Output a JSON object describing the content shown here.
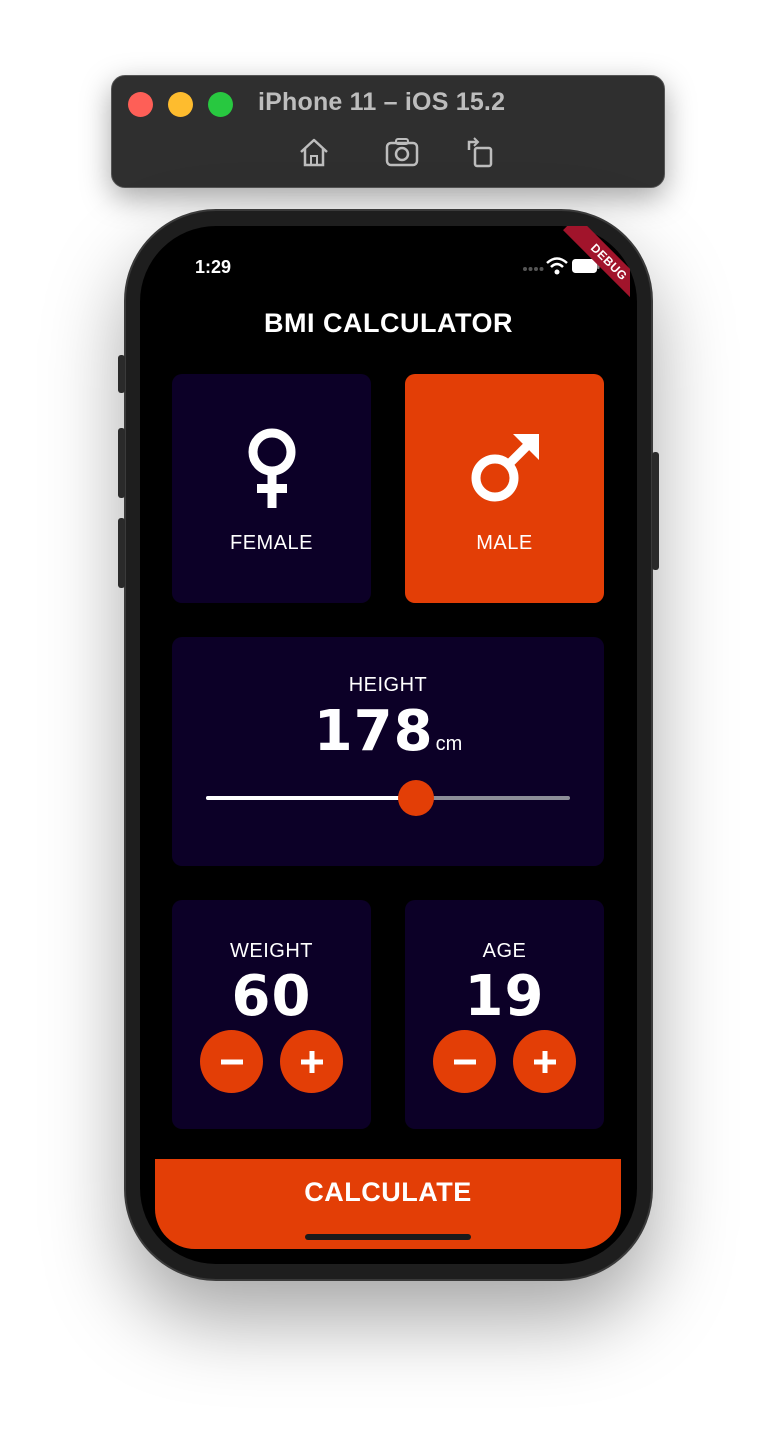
{
  "simulator": {
    "title": "iPhone 11 – iOS 15.2",
    "buttons": [
      "home-icon",
      "screenshot-icon",
      "rotate-icon"
    ]
  },
  "status_bar": {
    "time": "1:29",
    "debug_label": "DEBUG"
  },
  "app": {
    "title": "BMI CALCULATOR",
    "gender": {
      "female_label": "FEMALE",
      "male_label": "MALE",
      "selected": "male"
    },
    "height": {
      "label": "HEIGHT",
      "value": "178",
      "unit": "cm",
      "slider_fraction": 0.578
    },
    "weight": {
      "label": "WEIGHT",
      "value": "60"
    },
    "age": {
      "label": "AGE",
      "value": "19"
    },
    "calculate_label": "CALCULATE"
  },
  "colors": {
    "background": "#000000",
    "card": "#0c0027",
    "accent": "#e33e06",
    "slider_inactive": "#8d8e98",
    "debug_ribbon": "#a1142b"
  }
}
